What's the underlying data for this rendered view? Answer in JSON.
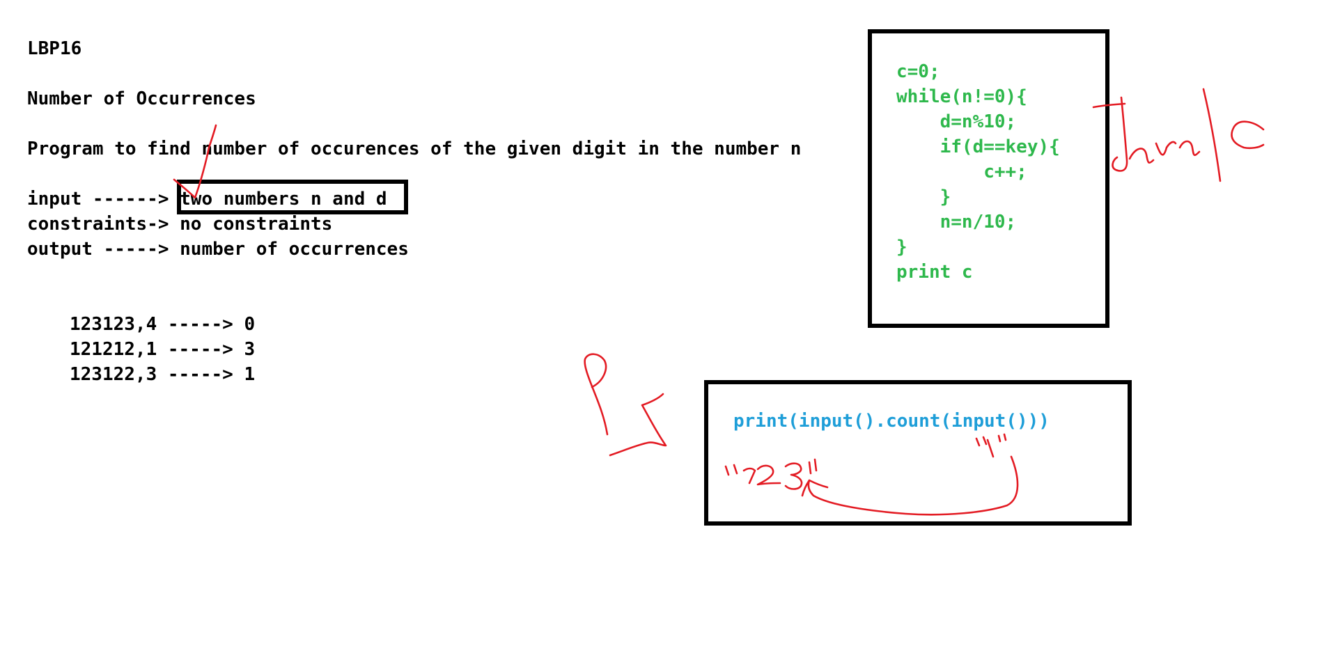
{
  "heading": {
    "code": "LBP16",
    "title": "Number of Occurrences",
    "description": "Program to find number of occurences of the given digit in the number n"
  },
  "spec": {
    "input_prefix": "input ------> ",
    "input_value": "two numbers n and d",
    "constraints_line": "constraints-> no constraints",
    "output_line": "output -----> number of occurrences"
  },
  "examples": [
    "123123,4 -----> 0",
    "121212,1 -----> 3",
    "123122,3 -----> 1"
  ],
  "java_c_code": [
    "c=0;",
    "while(n!=0){",
    "    d=n%10;",
    "    if(d==key){",
    "        c++;",
    "    }",
    "    n=n/10;",
    "}",
    "print c"
  ],
  "python_code": "print(input().count(input()))",
  "colors": {
    "text": "#000000",
    "java_code": "#2eb84c",
    "python_code": "#1e9ed8",
    "ink": "#e31b23"
  }
}
